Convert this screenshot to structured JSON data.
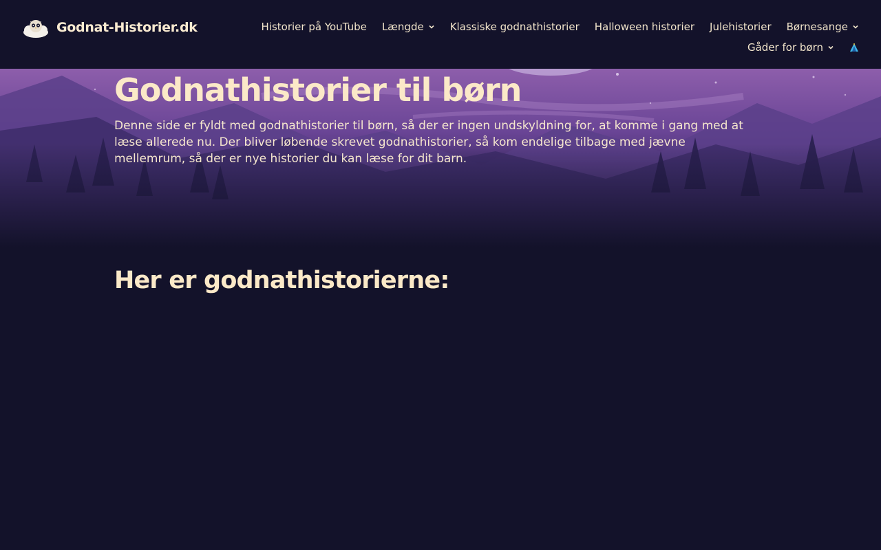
{
  "site": {
    "logo_text": "Godnat-Historier.dk"
  },
  "nav": {
    "row1": [
      {
        "label": "Historier på YouTube",
        "dropdown": false
      },
      {
        "label": "Længde",
        "dropdown": true
      },
      {
        "label": "Klassiske godnathistorier",
        "dropdown": false
      },
      {
        "label": "Halloween historier",
        "dropdown": false
      },
      {
        "label": "Julehistorier",
        "dropdown": false
      },
      {
        "label": "Børnesange",
        "dropdown": true
      }
    ],
    "row2": [
      {
        "label": "Gåder for børn",
        "dropdown": true
      }
    ],
    "extra_icon": "tent-icon"
  },
  "hero": {
    "title": "Godnathistorier til børn",
    "description": "Denne side er fyldt med godnathistorier til børn, så der er ingen undskyldning for, at komme i gang med at læse allerede nu. Der bliver løbende skrevet godnathistorier, så kom endelige tilbage med jævne mellemrum, så der er nye historier du kan læse for dit barn."
  },
  "section": {
    "title": "Her er godnathistorierne:"
  },
  "colors": {
    "background": "#13122a",
    "text": "#fbe9c8",
    "sky_top": "#8a5aa8",
    "mountain": "#5a3d88"
  }
}
